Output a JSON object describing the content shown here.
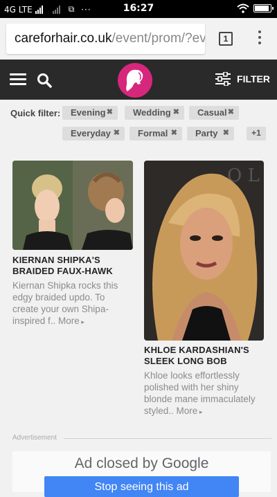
{
  "status_bar": {
    "network": "4G LTE",
    "time": "16:27",
    "battery_level": 0.95
  },
  "browser": {
    "url_domain": "careforhair.co.uk",
    "url_path": "/event/prom/?ev",
    "tab_count": "1"
  },
  "header": {
    "filter_label": "FILTER"
  },
  "quick_filter": {
    "label": "Quick filter:",
    "chips": [
      "Evening",
      "Wedding",
      "Casual",
      "Everyday",
      "Formal",
      "Party"
    ],
    "more": "+1"
  },
  "cards": [
    {
      "title_line1": "KIERNAN SHIPKA'S",
      "title_line2": "BRAIDED FAUX-HAWK",
      "desc_lines": [
        "Kiernan Shipka rocks this",
        "edgy braided updo. To",
        "create your own Shipa-",
        "inspired f.."
      ],
      "more": "More"
    },
    {
      "title_line1": "KHLOE KARDASHIAN'S",
      "title_line2": "SLEEK LONG BOB",
      "desc_lines": [
        "Khloe looks effortlessly",
        "polished with her shiny",
        "blonde mane immaculately",
        "styled.."
      ],
      "more": "More"
    }
  ],
  "ad": {
    "label": "Advertisement",
    "closed_text": "Ad closed by",
    "closed_brand": "Google",
    "stop_button": "Stop seeing this ad"
  },
  "colors": {
    "brand_pink": "#d6277c",
    "header_bg": "#2a2a2a",
    "ad_button": "#4285f4"
  }
}
